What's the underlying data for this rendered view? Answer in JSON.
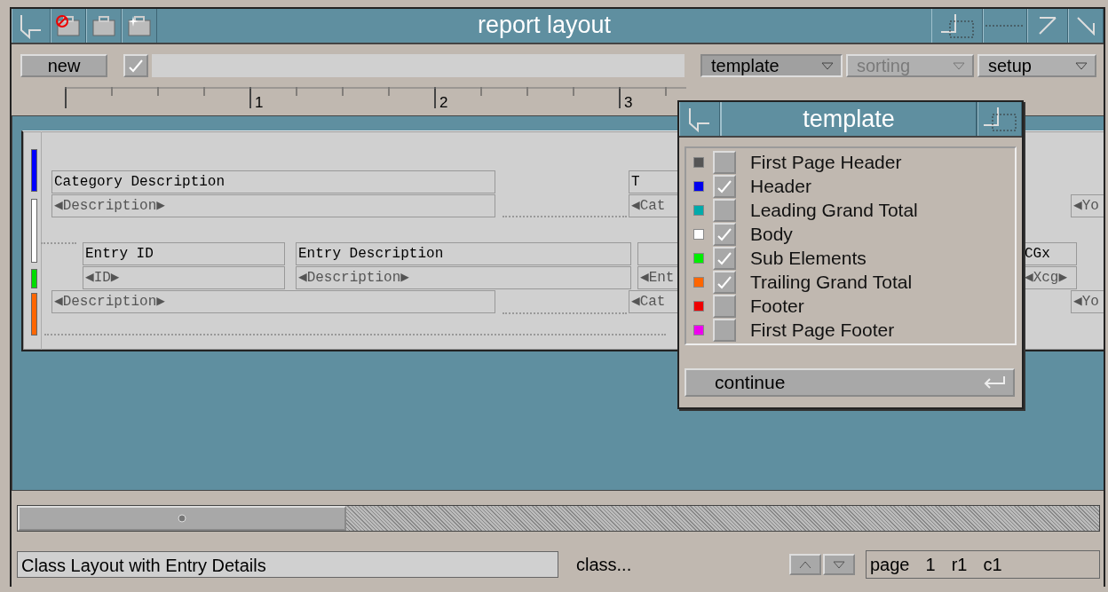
{
  "window": {
    "title": "report layout"
  },
  "toolbar": {
    "new_button": "new",
    "apply_checked": true,
    "menus": [
      {
        "label": "template",
        "selected": true,
        "disabled": false
      },
      {
        "label": "sorting",
        "selected": false,
        "disabled": true
      },
      {
        "label": "setup",
        "selected": false,
        "disabled": false
      }
    ]
  },
  "ruler": {
    "labels": [
      "1",
      "2",
      "3"
    ]
  },
  "report": {
    "bands": [
      {
        "color": "#0000ff"
      },
      {
        "color": "#ffffff"
      },
      {
        "color": "#00dd00"
      },
      {
        "color": "#ff6600"
      }
    ],
    "rows": [
      {
        "cells": [
          {
            "kind": "label",
            "text": "Category Description"
          },
          {
            "kind": "label",
            "text": "T"
          }
        ]
      },
      {
        "cells": [
          {
            "kind": "field",
            "text": "◀Description▶"
          },
          {
            "kind": "field",
            "text": "◀Cat"
          },
          {
            "kind": "field",
            "text": "◀Yo"
          }
        ]
      },
      {
        "cells": [
          {
            "kind": "label",
            "text": "Entry ID"
          },
          {
            "kind": "label",
            "text": "Entry Description"
          },
          {
            "kind": "label",
            "text": ""
          },
          {
            "kind": "label",
            "text": "CGx"
          }
        ]
      },
      {
        "cells": [
          {
            "kind": "field",
            "text": "◀ID▶"
          },
          {
            "kind": "field",
            "text": "◀Description▶"
          },
          {
            "kind": "field",
            "text": "◀Ent"
          },
          {
            "kind": "field",
            "text": "◀Xcg▶"
          }
        ]
      },
      {
        "cells": [
          {
            "kind": "field",
            "text": "◀Description▶"
          },
          {
            "kind": "field",
            "text": "◀Cat"
          },
          {
            "kind": "field",
            "text": "◀Yo"
          }
        ]
      }
    ]
  },
  "template_dialog": {
    "title": "template",
    "items": [
      {
        "label": "First Page Header",
        "color": "#555555",
        "checked": false
      },
      {
        "label": "Header",
        "color": "#0000ee",
        "checked": true
      },
      {
        "label": "Leading Grand Total",
        "color": "#00aaaa",
        "checked": false
      },
      {
        "label": "Body",
        "color": "#ffffff",
        "checked": true
      },
      {
        "label": "Sub Elements",
        "color": "#00ee00",
        "checked": true
      },
      {
        "label": "Trailing Grand Total",
        "color": "#ff6600",
        "checked": true
      },
      {
        "label": "Footer",
        "color": "#ee0000",
        "checked": false
      },
      {
        "label": "First Page Footer",
        "color": "#ee00ee",
        "checked": false
      }
    ],
    "continue_button": "continue"
  },
  "status_bar": {
    "message": "Class Layout with Entry Details",
    "class_label": "class...",
    "page_label": "page",
    "page": "1",
    "row": "r1",
    "column": "c1"
  }
}
